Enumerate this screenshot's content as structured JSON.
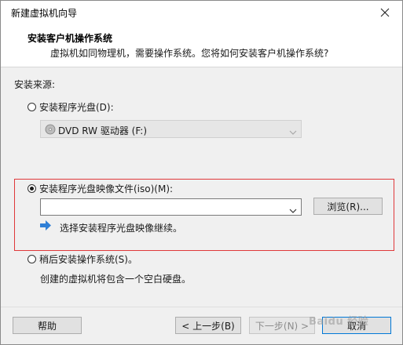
{
  "window": {
    "title": "新建虚拟机向导",
    "close_glyph": "✕"
  },
  "header": {
    "title": "安装客户机操作系统",
    "subtitle": "虚拟机如同物理机，需要操作系统。您将如何安装客户机操作系统?"
  },
  "source_label": "安装来源:",
  "options": {
    "disc": {
      "label": "安装程序光盘(D):",
      "checked": false,
      "drive_value": "DVD RW 驱动器 (F:)"
    },
    "iso": {
      "label": "安装程序光盘映像文件(iso)(M):",
      "checked": true,
      "path_value": "",
      "browse_label": "浏览(R)...",
      "hint": "选择安装程序光盘映像继续。"
    },
    "later": {
      "label": "稍后安装操作系统(S)。",
      "checked": false,
      "description": "创建的虚拟机将包含一个空白硬盘。"
    }
  },
  "footer": {
    "help_label": "帮助",
    "back_label": "< 上一步(B)",
    "next_label": "下一步(N) >",
    "cancel_label": "取消"
  },
  "watermark": "Baidu 经验",
  "colors": {
    "highlight_border": "#e0383a",
    "hint_arrow": "#2f7fd6",
    "default_button_border": "#0078d7"
  }
}
